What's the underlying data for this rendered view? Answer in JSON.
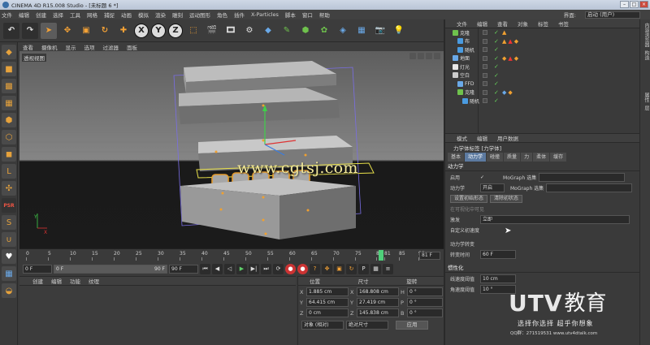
{
  "title_bar": {
    "title": "CINEMA 4D R15.008 Studio - [未标题 6 *]"
  },
  "menu": {
    "items": [
      "文件",
      "编辑",
      "创建",
      "选择",
      "工具",
      "网格",
      "捕捉",
      "动画",
      "模拟",
      "渲染",
      "雕刻",
      "运动图形",
      "角色",
      "插件",
      "X-Particles",
      "脚本",
      "窗口",
      "帮助"
    ],
    "layout_label": "界面:",
    "layout_value": "启动 (用户)"
  },
  "viewport": {
    "menu": [
      "查看",
      "摄像机",
      "显示",
      "选项",
      "过滤器",
      "面板"
    ],
    "view_label": "透视视图"
  },
  "timeline": {
    "ticks": [
      "0",
      "5",
      "10",
      "15",
      "20",
      "25",
      "30",
      "35",
      "40",
      "45",
      "50",
      "55",
      "60",
      "65",
      "70",
      "75",
      "80",
      "81",
      "85",
      "90"
    ],
    "current_frame": 81,
    "end_display": "81 F"
  },
  "transport": {
    "start_field": "0 F",
    "range_start": "0 F",
    "range_end": "90 F",
    "end_field": "90 F"
  },
  "material_panel": {
    "menu": [
      "创建",
      "编辑",
      "功能",
      "纹理"
    ]
  },
  "coord_panel": {
    "headers": [
      "位置",
      "尺寸",
      "旋转"
    ],
    "rows": [
      {
        "axis": "X",
        "pos": "1.885 cm",
        "size": "168.808 cm",
        "rot_axis": "H",
        "rot": "0 °"
      },
      {
        "axis": "Y",
        "pos": "64.415 cm",
        "size": "27.419 cm",
        "rot_axis": "P",
        "rot": "0 °"
      },
      {
        "axis": "Z",
        "pos": "0 cm",
        "size": "145.838 cm",
        "rot_axis": "B",
        "rot": "0 °"
      }
    ],
    "mode_1": "对象 (相对)",
    "mode_2": "绝对尺寸",
    "apply": "应用"
  },
  "object_manager": {
    "menu": [
      "文件",
      "编辑",
      "查看",
      "对象",
      "标签",
      "书签"
    ],
    "objects": [
      {
        "name": "克隆",
        "indent": 0,
        "color": "#6fc24d"
      },
      {
        "name": "布",
        "indent": 1,
        "color": "#4a9be0"
      },
      {
        "name": "随机",
        "indent": 1,
        "color": "#4a9be0"
      },
      {
        "name": "地面",
        "indent": 0,
        "color": "#6aa9e8"
      },
      {
        "name": "灯光",
        "indent": 0,
        "color": "#e8e8e8"
      },
      {
        "name": "空白",
        "indent": 0,
        "color": "#cccccc"
      },
      {
        "name": "FFD",
        "indent": 1,
        "color": "#6aa9e8"
      },
      {
        "name": "克隆",
        "indent": 1,
        "color": "#6fc24d"
      },
      {
        "name": "随机",
        "indent": 2,
        "color": "#4a9be0"
      }
    ]
  },
  "attribute_manager": {
    "menu": [
      "模式",
      "编辑",
      "用户数据"
    ],
    "title": "力学体标签 [力学体]",
    "tabs": [
      "基本",
      "动力学",
      "碰撞",
      "质量",
      "力",
      "柔体",
      "缓存"
    ],
    "active_tab": "动力学",
    "section_dynamics": "动力学",
    "enable_label": "启用",
    "enable_check": "✓",
    "dynamics_label": "动力学",
    "dynamics_value": "开启",
    "mograph_select_label": "MoGraph 选集",
    "set_initial_btn": "设置初始形态",
    "clear_initial_btn": "清除初状态",
    "visible_label": "在可视化中可见",
    "trigger_label": "激发",
    "trigger_value": "立即",
    "custom_velocity_label": "自定义初速度",
    "dynamic_transition_label": "动力学转变",
    "transition_time_label": "转变时间",
    "transition_time_value": "60 F",
    "section_inertia": "惯性化",
    "linear_threshold_label": "线速度阈值",
    "linear_threshold_value": "10 cm",
    "angular_threshold_label": "角速度阈值",
    "angular_threshold_value": "10 °"
  },
  "right_sidebar": {
    "labels": [
      "内容浏览器",
      "构造",
      "属性",
      "层"
    ]
  },
  "watermarks": {
    "site": "www.cgtsj.com",
    "logo_a": "UTV",
    "logo_b": "教育",
    "slogan": "选择你选择 超乎你想象",
    "qq": "QQ群：271519531  www.utv4dtalk.com"
  },
  "colors": {
    "accent_orange": "#f4a236",
    "timeline_cursor": "#4fd07a",
    "active_tab": "#5c7aa0"
  }
}
